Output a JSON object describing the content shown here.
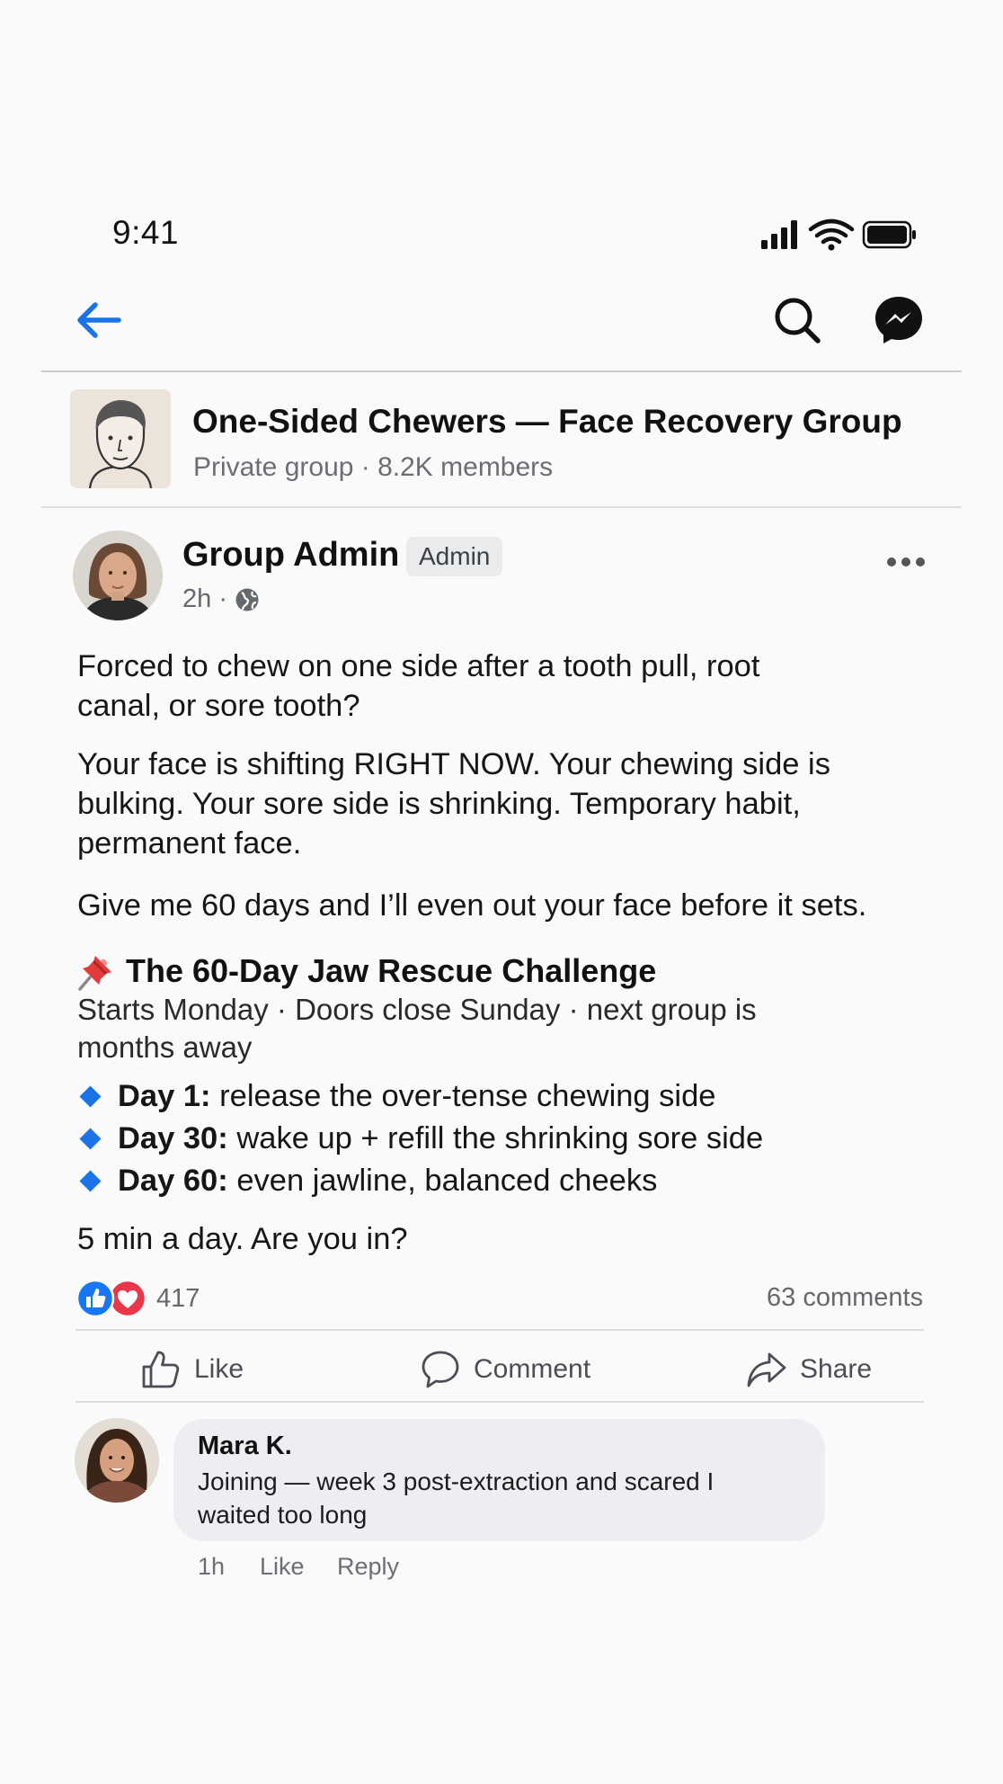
{
  "status_bar": {
    "time": "9:41"
  },
  "nav": {
    "icons": [
      "back-arrow-icon",
      "search-icon",
      "messenger-icon"
    ]
  },
  "group": {
    "name": "One-Sided Chewers — Face Recovery Group",
    "meta": "Private group · 8.2K members"
  },
  "post": {
    "author": "Group Admin",
    "badge": "Admin",
    "time": "2h ·",
    "paragraph1": "Forced to chew on one side after a tooth pull, root canal, or sore tooth?",
    "paragraph2": "Your face is shifting RIGHT NOW. Your chewing side is bulking. Your sore side is shrinking. Temporary habit, permanent face.",
    "paragraph3": "Give me 60 days and I’ll even out your face before it sets.",
    "challenge_title": "The 60-Day Jaw Rescue Challenge",
    "challenge_sub": "Starts Monday · Doors close Sunday · next group is months away",
    "days": [
      {
        "label": "Day 1:",
        "text": "release the over-tense chewing side"
      },
      {
        "label": "Day 30:",
        "text": "wake up + refill the shrinking sore side"
      },
      {
        "label": "Day 60:",
        "text": "even jawline, balanced cheeks"
      }
    ],
    "closing": "5 min a day. Are you in?",
    "reactions_count": "417",
    "comments_count": "63 comments",
    "actions": {
      "like": "Like",
      "comment": "Comment",
      "share": "Share"
    }
  },
  "comment": {
    "author": "Mara K.",
    "text": "Joining — week 3 post-extraction and scared I waited too long",
    "time": "1h",
    "like": "Like",
    "reply": "Reply"
  },
  "colors": {
    "accent": "#1a73e8",
    "like_blue": "#1877f2",
    "love_red": "#e8374b"
  }
}
